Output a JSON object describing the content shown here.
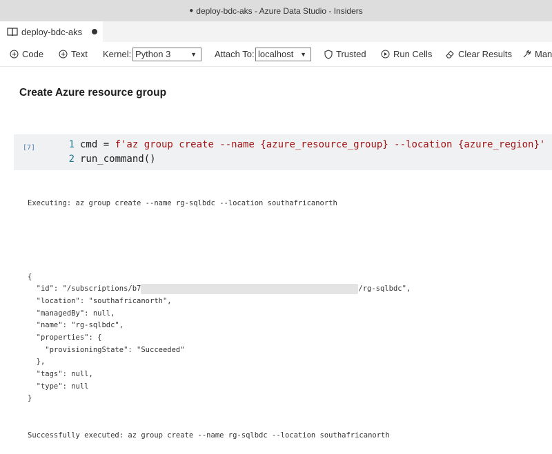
{
  "window": {
    "title": "deploy-bdc-aks - Azure Data Studio - Insiders",
    "dirty_marker": "●"
  },
  "tab": {
    "label": "deploy-bdc-aks",
    "icon": "notebook-book-icon"
  },
  "toolbar": {
    "code_label": "Code",
    "text_label": "Text",
    "kernel_label": "Kernel:",
    "kernel_value": "Python 3",
    "attach_label": "Attach To:",
    "attach_value": "localhost",
    "trusted_label": "Trusted",
    "run_cells_label": "Run Cells",
    "clear_results_label": "Clear Results",
    "manage_label": "Man"
  },
  "notebook": {
    "heading": "Create Azure resource group",
    "cell": {
      "execution_count": "[7]",
      "lines": [
        {
          "number": "1",
          "parts": [
            {
              "t": "cmd = ",
              "c": "plain"
            },
            {
              "t": "f'az group create --name ",
              "c": "str"
            },
            {
              "t": "{azure_resource_group}",
              "c": "str"
            },
            {
              "t": " --location ",
              "c": "str"
            },
            {
              "t": "{azure_region}",
              "c": "str"
            },
            {
              "t": "'",
              "c": "str"
            }
          ]
        },
        {
          "number": "2",
          "parts": [
            {
              "t": "run_command()",
              "c": "plain"
            }
          ]
        }
      ]
    },
    "output": {
      "executing": "Executing: az group create --name rg-sqlbdc --location southafricanorth",
      "json_lines": [
        "{",
        "  \"id\": \"/subscriptions/b7",
        "  \"location\": \"southafricanorth\",",
        "  \"managedBy\": null,",
        "  \"name\": \"rg-sqlbdc\",",
        "  \"properties\": {",
        "    \"provisioningState\": \"Succeeded\"",
        "  },",
        "  \"tags\": null,",
        "  \"type\": null",
        "}"
      ],
      "id_suffix": "/rg-sqlbdc\",",
      "success": "Successfully executed: az group create --name rg-sqlbdc --location southafricanorth"
    }
  }
}
